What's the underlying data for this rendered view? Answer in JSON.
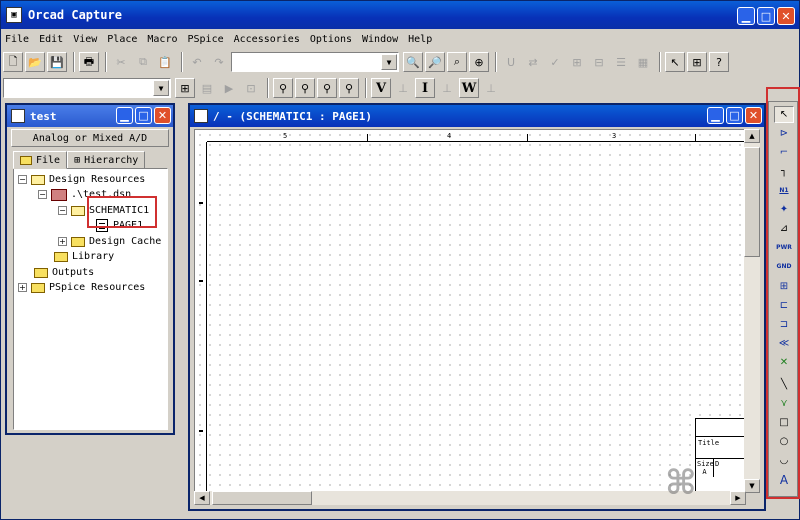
{
  "app": {
    "title": "Orcad Capture"
  },
  "menu": [
    "File",
    "Edit",
    "View",
    "Place",
    "Macro",
    "PSpice",
    "Accessories",
    "Options",
    "Window",
    "Help"
  ],
  "toolbar2": {
    "letters": [
      "V",
      "I",
      "W"
    ]
  },
  "project": {
    "title": "test",
    "design_type": "Analog or Mixed A/D",
    "tabs": [
      "File",
      "Hierarchy"
    ],
    "tree": {
      "design_resources": "Design Resources",
      "dsn": ".\\test.dsn",
      "schematic": "SCHEMATIC1",
      "page": "PAGE1",
      "design_cache": "Design Cache",
      "library": "Library",
      "outputs": "Outputs",
      "pspice_resources": "PSpice Resources"
    }
  },
  "schematic": {
    "title": "/ - (SCHEMATIC1 : PAGE1)",
    "ruler_labels": [
      "5",
      "4",
      "3"
    ],
    "titleblock": {
      "title": "Title",
      "size": "Size",
      "size_value": "A",
      "doc": "D"
    }
  },
  "palette": {
    "labels": [
      "N1",
      "PWR",
      "GND",
      "A"
    ]
  }
}
